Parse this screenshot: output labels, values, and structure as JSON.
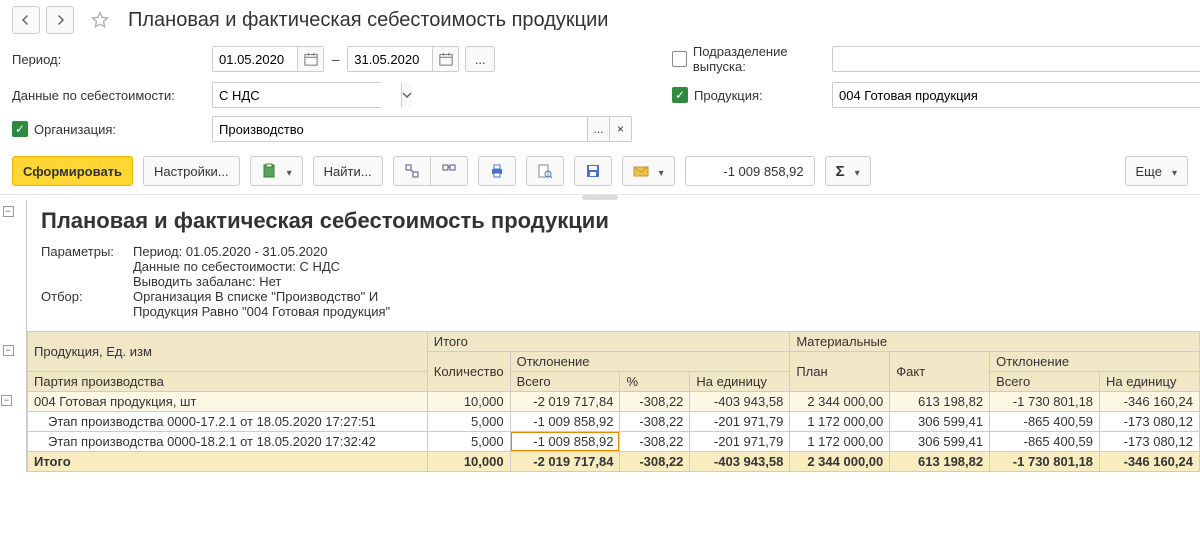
{
  "title": "Плановая и фактическая себестоимость продукции",
  "filters": {
    "period_label": "Период:",
    "date_from": "01.05.2020",
    "date_to": "31.05.2020",
    "cost_data_label": "Данные по себестоимости:",
    "cost_data_value": "С НДС",
    "org_label": "Организация:",
    "org_value": "Производство",
    "dept_label": "Подразделение выпуска:",
    "dept_value": "",
    "product_label": "Продукция:",
    "product_value": "004 Готовая продукция",
    "ellipsis": "..."
  },
  "toolbar": {
    "generate": "Сформировать",
    "settings": "Настройки...",
    "find": "Найти...",
    "num_display": "-1 009 858,92",
    "more": "Еще"
  },
  "report": {
    "title": "Плановая и фактическая себестоимость продукции",
    "params_label": "Параметры:",
    "params_lines": [
      "Период: 01.05.2020 - 31.05.2020",
      "Данные по себестоимости: С НДС",
      "Выводить забаланс: Нет"
    ],
    "filter_label": "Отбор:",
    "filter_lines": [
      "Организация В списке \"Производство\" И",
      "Продукция Равно \"004 Готовая продукция\""
    ],
    "headers": {
      "product": "Продукция, Ед. изм",
      "batch": "Партия производства",
      "total": "Итого",
      "qty": "Количество",
      "deviation": "Отклонение",
      "dev_total": "Всего",
      "dev_percent": "%",
      "dev_unit": "На единицу",
      "materials": "Материальные",
      "plan": "План",
      "fact": "Факт"
    },
    "rows": [
      {
        "type": "product",
        "name": "004 Готовая продукция, шт",
        "qty": "10,000",
        "dev_total": "-2 019 717,84",
        "dev_pct": "-308,22",
        "dev_unit": "-403 943,58",
        "plan": "2 344 000,00",
        "fact": "613 198,82",
        "mdev_total": "-1 730 801,18",
        "mdev_unit": "-346 160,24"
      },
      {
        "type": "stage",
        "name": "Этап производства 0000-17.2.1 от 18.05.2020 17:27:51",
        "qty": "5,000",
        "dev_total": "-1 009 858,92",
        "dev_pct": "-308,22",
        "dev_unit": "-201 971,79",
        "plan": "1 172 000,00",
        "fact": "306 599,41",
        "mdev_total": "-865 400,59",
        "mdev_unit": "-173 080,12"
      },
      {
        "type": "stage",
        "name": "Этап производства 0000-18.2.1 от 18.05.2020 17:32:42",
        "qty": "5,000",
        "dev_total": "-1 009 858,92",
        "dev_pct": "-308,22",
        "dev_unit": "-201 971,79",
        "plan": "1 172 000,00",
        "fact": "306 599,41",
        "mdev_total": "-865 400,59",
        "mdev_unit": "-173 080,12"
      }
    ],
    "total_row": {
      "name": "Итого",
      "qty": "10,000",
      "dev_total": "-2 019 717,84",
      "dev_pct": "-308,22",
      "dev_unit": "-403 943,58",
      "plan": "2 344 000,00",
      "fact": "613 198,82",
      "mdev_total": "-1 730 801,18",
      "mdev_unit": "-346 160,24"
    }
  }
}
